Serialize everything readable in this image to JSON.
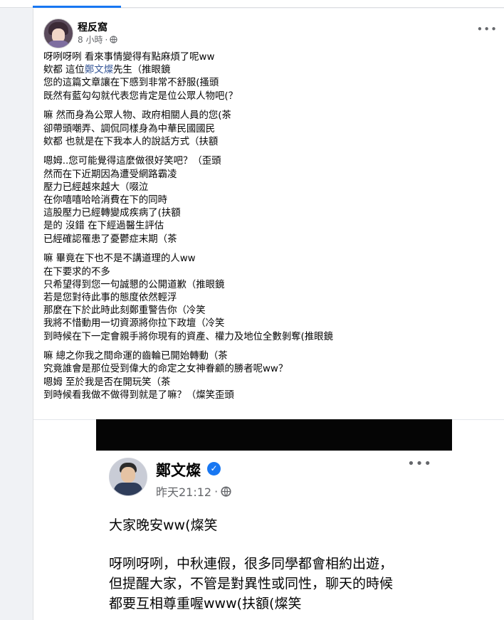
{
  "post": {
    "author": "程反窩",
    "time": "8 小時",
    "meta_separator": "·",
    "more_label": "•••",
    "paragraphs": [
      [
        "呀咧呀咧 看來事情變得有點麻煩了呢ww",
        "欸都 這位@MENTION先生（推眼鏡",
        "您的這篇文章讓在下感到非常不舒服(搔頭",
        "既然有藍勾勾就代表您肯定是位公眾人物吧(？"
      ],
      [
        "嘛 然而身為公眾人物、政府相關人員的您(茶",
        "卻帶頭嘲弄、調侃同樣身為中華民國國民",
        "欸都 也就是在下我本人的說話方式（扶額"
      ],
      [
        "嗯姆..您可能覺得這麼做很好笑吧？（歪頭",
        "然而在下近期因為遭受網路霸凌",
        "壓力已經越來越大（啜泣",
        "在你嘻嘻哈哈消費在下的同時",
        "這股壓力已經轉變成疾病了(扶額",
        "是的 沒錯 在下經過醫生評估",
        "已經確認罹患了憂鬱症末期（茶"
      ],
      [
        "嘛 畢竟在下也不是不講道理的人ww",
        "在下要求的不多",
        "只希望得到您一句誠懇的公開道歉（推眼鏡",
        "若是您對待此事的態度依然輕浮",
        "那麼在下於此時此刻鄭重警告你（冷笑",
        "我將不惜動用一切資源將你拉下政壇（冷笑",
        "到時候在下一定會親手將你現有的資產、權力及地位全數剝奪(推眼鏡"
      ],
      [
        "嘛 總之你我之間命運的齒輪已開始轉動（茶",
        "究竟誰會是那位受到偉大的命定之女神眷顧的勝者呢ww？",
        "嗯姆 至於我是否在開玩笑（茶",
        "到時候看我做不做得到就是了嘛？（燦笑歪頭"
      ]
    ],
    "mention": "鄭文燦"
  },
  "screenshot": {
    "name": "鄭文燦",
    "time": "昨天21:12",
    "meta_separator": "·",
    "more_label": "•••",
    "verified_icon": "verified-check-icon",
    "line1": "大家晚安ww(燦笑",
    "lines": [
      "呀咧呀咧，中秋連假，很多同學都會相約出遊，",
      "但提醒大家，不管是對異性或同性，聊天的時候",
      "都要互相尊重喔www(扶額(燦笑"
    ]
  },
  "colors": {
    "accent": "#1877f2",
    "mention": "#385898",
    "secondary_text": "#65676b",
    "background": "#f0f2f5"
  }
}
